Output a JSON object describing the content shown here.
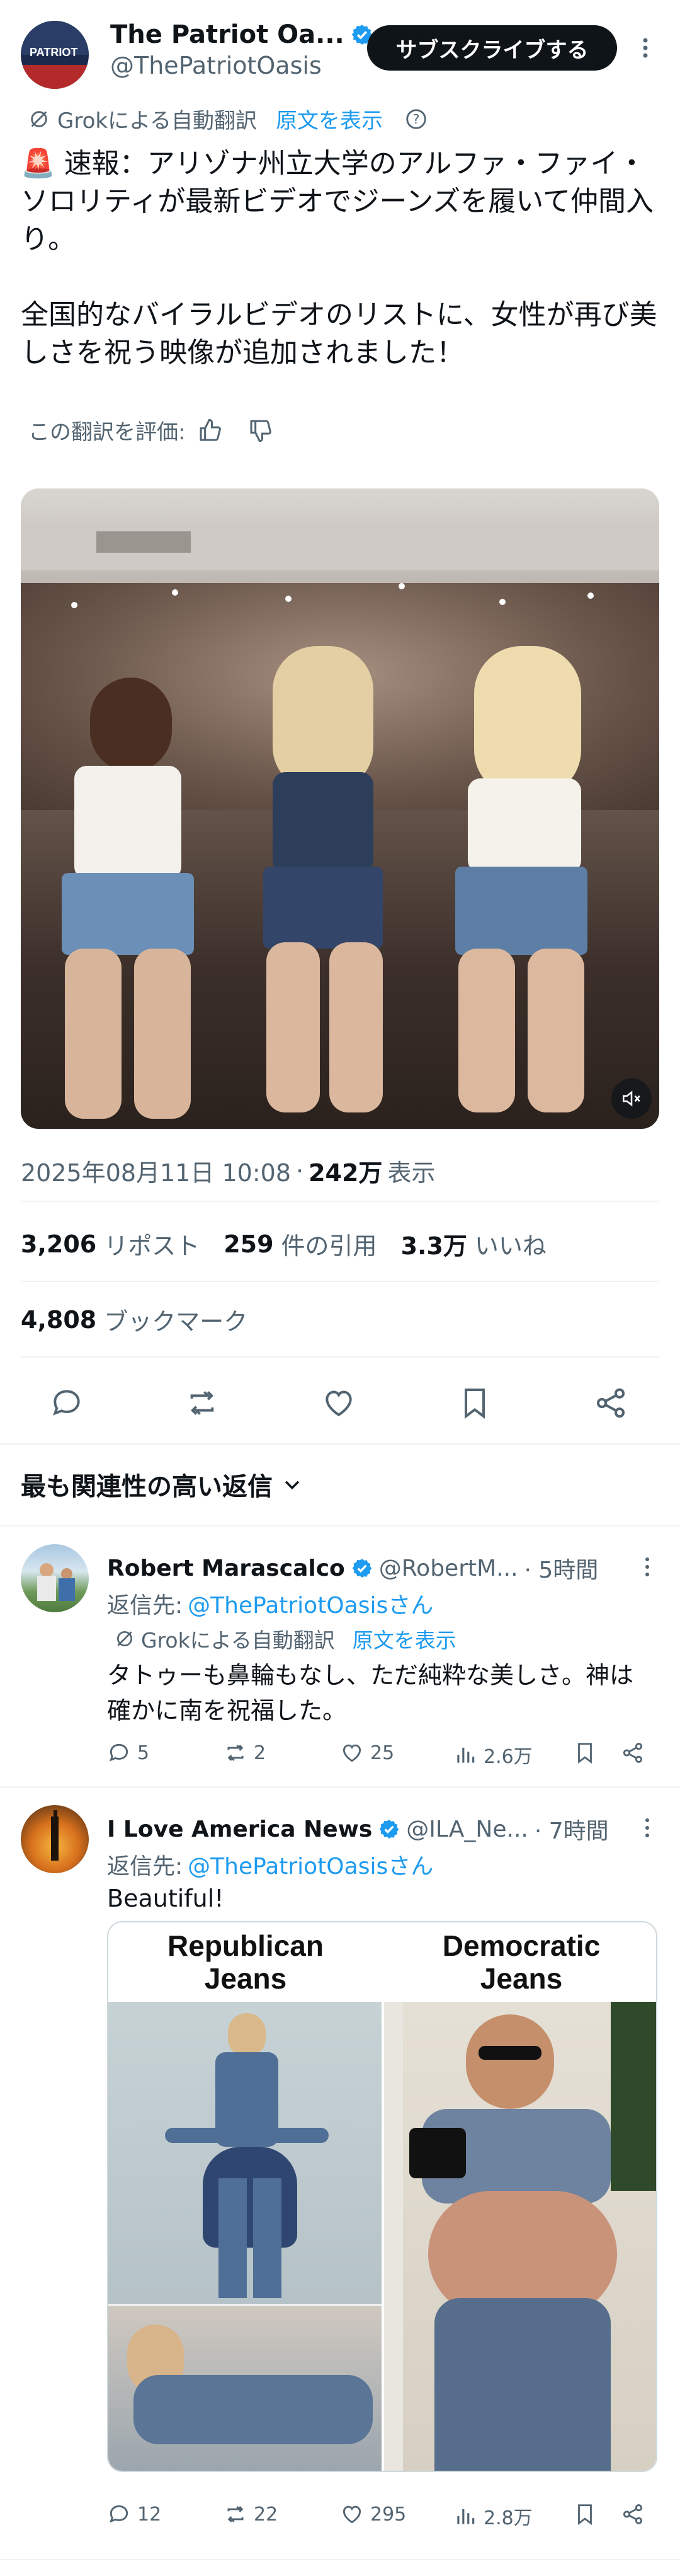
{
  "header": {
    "author_name": "The Patriot Oa...",
    "author_handle": "@ThePatriotOasis",
    "subscribe_label": "サブスクライブする",
    "avatar_text": "PATRIOT"
  },
  "translation": {
    "label": "Grokによる自動翻訳",
    "show_original": "原文を表示"
  },
  "tweet": {
    "emoji": "🚨",
    "paragraph1": "速報：アリゾナ州立大学のアルファ・ファイ・ソロリティが最新ビデオでジーンズを履いて仲間入り。",
    "paragraph2": "全国的なバイラルビデオのリストに、女性が再び美しさを祝う映像が追加されました！",
    "rate_translation": "この翻訳を評価:"
  },
  "meta": {
    "timestamp": "2025年08月11日 10:08",
    "separator": "·",
    "views": "242万",
    "views_label": "表示"
  },
  "stats": {
    "reposts": "3,206",
    "reposts_label": "リポスト",
    "quotes": "259",
    "quotes_label": "件の引用",
    "likes": "3.3万",
    "likes_label": "いいね",
    "bookmarks": "4,808",
    "bookmarks_label": "ブックマーク"
  },
  "replies_header": {
    "label": "最も関連性の高い返信"
  },
  "replies": [
    {
      "name": "Robert Marascalco",
      "handle": "@RobertM...",
      "time": "· 5時間",
      "reply_to_prefix": "返信先:",
      "reply_to": "@ThePatriotOasisさん",
      "translation_label": "Grokによる自動翻訳",
      "show_original": "原文を表示",
      "text": "タトゥーも鼻輪もなし、ただ純粋な美しさ。神は確かに南を祝福した。",
      "replies": "5",
      "reposts": "2",
      "likes": "25",
      "views": "2.6万"
    },
    {
      "name": "I Love America News",
      "handle": "@ILA_Ne...",
      "time": "· 7時間",
      "reply_to_prefix": "返信先:",
      "reply_to": "@ThePatriotOasisさん",
      "text": "Beautiful!",
      "image_left_title": "Republican\nJeans",
      "image_right_title": "Democratic\nJeans",
      "replies": "12",
      "reposts": "22",
      "likes": "295",
      "views": "2.8万"
    }
  ]
}
